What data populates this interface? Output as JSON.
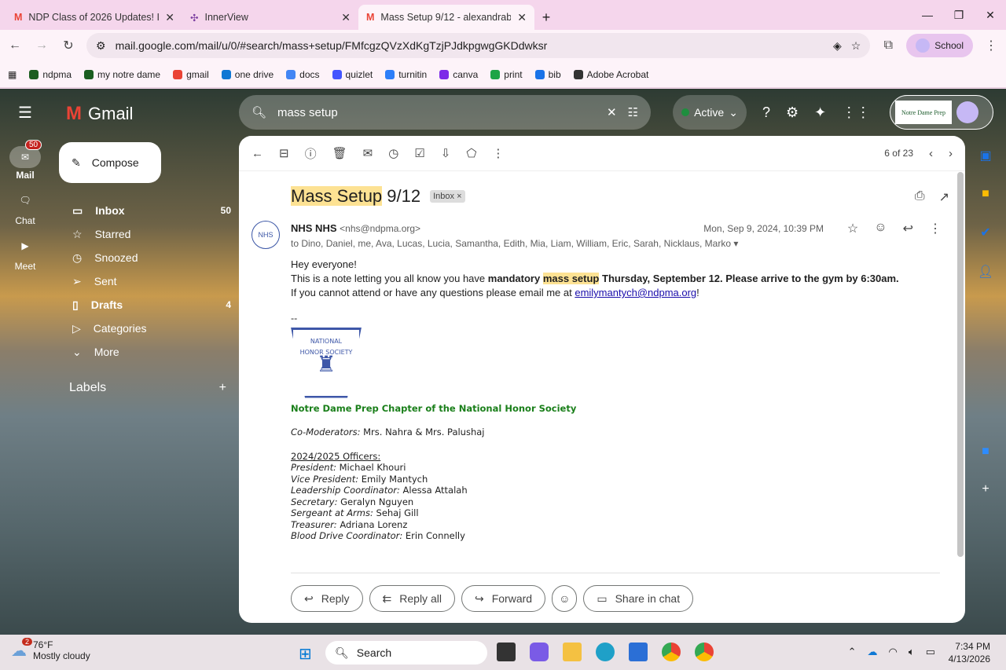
{
  "browser": {
    "tabs": [
      {
        "title": "NDP Class of 2026 Updates! Im",
        "icon": "gmail-icon"
      },
      {
        "title": "InnerView",
        "icon": "innerview-icon"
      },
      {
        "title": "Mass Setup 9/12 - alexandraba",
        "icon": "gmail-icon",
        "active": true
      }
    ],
    "url": "mail.google.com/mail/u/0/#search/mass+setup/FMfcgzQVzXdKgTzjPJdkpgwgGKDdwksr",
    "profile": "School",
    "bookmarks": [
      {
        "label": "ndpma",
        "color": "#1b5e20"
      },
      {
        "label": "my notre dame",
        "color": "#1b5e20"
      },
      {
        "label": "gmail",
        "color": "#ea4335"
      },
      {
        "label": "one drive",
        "color": "#0f78d4"
      },
      {
        "label": "docs",
        "color": "#4285f4"
      },
      {
        "label": "quizlet",
        "color": "#4255ff"
      },
      {
        "label": "turnitin",
        "color": "#2d7ff9"
      },
      {
        "label": "canva",
        "color": "#7d2ae8"
      },
      {
        "label": "print",
        "color": "#1ea446"
      },
      {
        "label": "bib",
        "color": "#1a73e8"
      },
      {
        "label": "Adobe Acrobat",
        "color": "#333333"
      }
    ]
  },
  "gmail": {
    "brand": "Gmail",
    "rail": [
      {
        "label": "Mail",
        "badge": "50"
      },
      {
        "label": "Chat"
      },
      {
        "label": "Meet"
      }
    ],
    "compose": "Compose",
    "nav": [
      {
        "label": "Inbox",
        "count": "50",
        "icon": "inbox-icon",
        "bold": true
      },
      {
        "label": "Starred",
        "icon": "star-icon"
      },
      {
        "label": "Snoozed",
        "icon": "clock-icon"
      },
      {
        "label": "Sent",
        "icon": "send-icon"
      },
      {
        "label": "Drafts",
        "count": "4",
        "icon": "draft-icon",
        "bold": true
      },
      {
        "label": "Categories",
        "icon": "label-icon"
      },
      {
        "label": "More",
        "icon": "chevron-down-icon"
      }
    ],
    "labels_heading": "Labels",
    "search_value": "mass setup",
    "status": "Active",
    "account_logo": "Notre Dame Preparatory School",
    "pager": "6 of 23"
  },
  "email": {
    "subject_highlight": "Mass Setup",
    "subject_rest": " 9/12",
    "label": "Inbox",
    "sender_name": "NHS NHS",
    "sender_email": "<nhs@ndpma.org>",
    "date": "Mon, Sep 9, 2024, 10:39 PM",
    "to": "to Dino, Daniel, me, Ava, Lucas, Lucia, Samantha, Edith, Mia, Liam, William, Eric, Sarah, Nicklaus, Marko",
    "greeting": "Hey everyone!",
    "line2_a": "This is a note letting you all know you have ",
    "line2_b": "mandatory ",
    "line2_hl": "mass setup",
    "line2_c": " Thursday, September 12. Please arrive to the gym by 6:30am.",
    "line3_a": "If you cannot attend or have any questions please email me at ",
    "line3_link": "emilymantych@ndpma.org",
    "line3_b": "!",
    "sig_dash": "--",
    "logo_text": "NATIONAL HONOR SOCIETY",
    "chapter": "Notre Dame Prep Chapter of the National Honor Society",
    "comod_label": "Co-Moderators:",
    "comod": " Mrs. Nahra & Mrs. Palushaj",
    "officers_heading": "2024/2025 Officers:",
    "officers": [
      {
        "role": "President:",
        "name": " Michael Khouri"
      },
      {
        "role": "Vice President:",
        "name": " Emily Mantych"
      },
      {
        "role": "Leadership Coordinator:",
        "name": " Alessa Attalah"
      },
      {
        "role": "Secretary:",
        "name": " Geralyn Nguyen"
      },
      {
        "role": "Sergeant at Arms:",
        "name": " Sehaj Gill"
      },
      {
        "role": "Treasurer:",
        "name": " Adriana Lorenz"
      },
      {
        "role": "Blood Drive Coordinator:",
        "name": " Erin Connelly"
      }
    ],
    "actions": [
      "Reply",
      "Reply all",
      "Forward",
      "Share in chat"
    ]
  },
  "taskbar": {
    "weather_badge": "2",
    "temp": "76°F",
    "condition": "Mostly cloudy",
    "search": "Search",
    "time": "7:34 PM",
    "date": "4/13/2026"
  }
}
